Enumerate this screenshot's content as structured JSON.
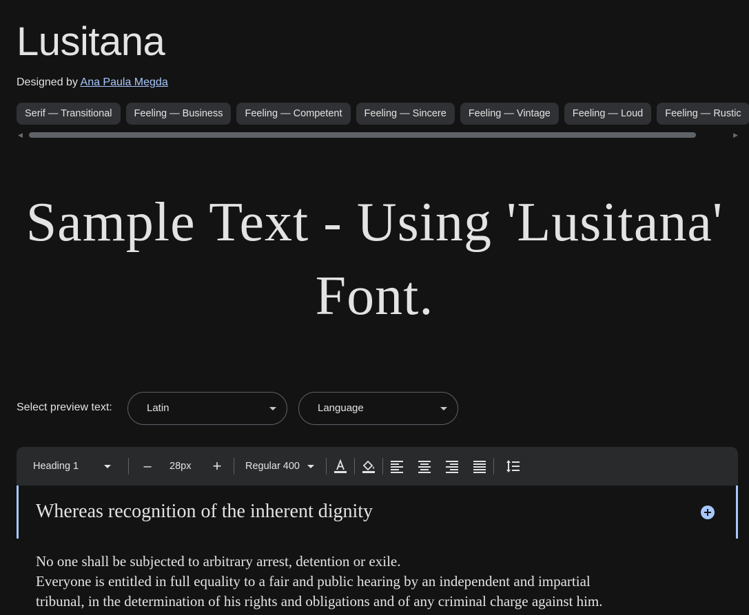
{
  "font": {
    "name": "Lusitana",
    "designer_prefix": "Designed by",
    "designer_name": "Ana Paula Megda"
  },
  "tags": [
    "Serif — Transitional",
    "Feeling — Business",
    "Feeling — Competent",
    "Feeling — Sincere",
    "Feeling — Vintage",
    "Feeling — Loud",
    "Feeling — Rustic"
  ],
  "sample_text": "Sample Text - Using 'Lusitana' Font.",
  "preview": {
    "label": "Select preview text:",
    "script_value": "Latin",
    "language_value": "Language"
  },
  "toolbar": {
    "style_value": "Heading 1",
    "size_value": "28px",
    "weight_value": "Regular 400",
    "decrease_label": "–",
    "increase_label": "+"
  },
  "editor": {
    "heading": "Whereas recognition of the inherent dignity",
    "paragraph_lines": [
      "No one shall be subjected to arbitrary arrest, detention or exile.",
      "Everyone is entitled in full equality to a fair and public hearing by an independent and impartial",
      "tribunal, in the determination of his rights and obligations and of any criminal charge against him."
    ]
  },
  "colors": {
    "background": "#131314",
    "chip_bg": "#303134",
    "toolbar_bg": "#282a2c",
    "accent": "#a8c7fa",
    "text": "#e3e3e3"
  }
}
